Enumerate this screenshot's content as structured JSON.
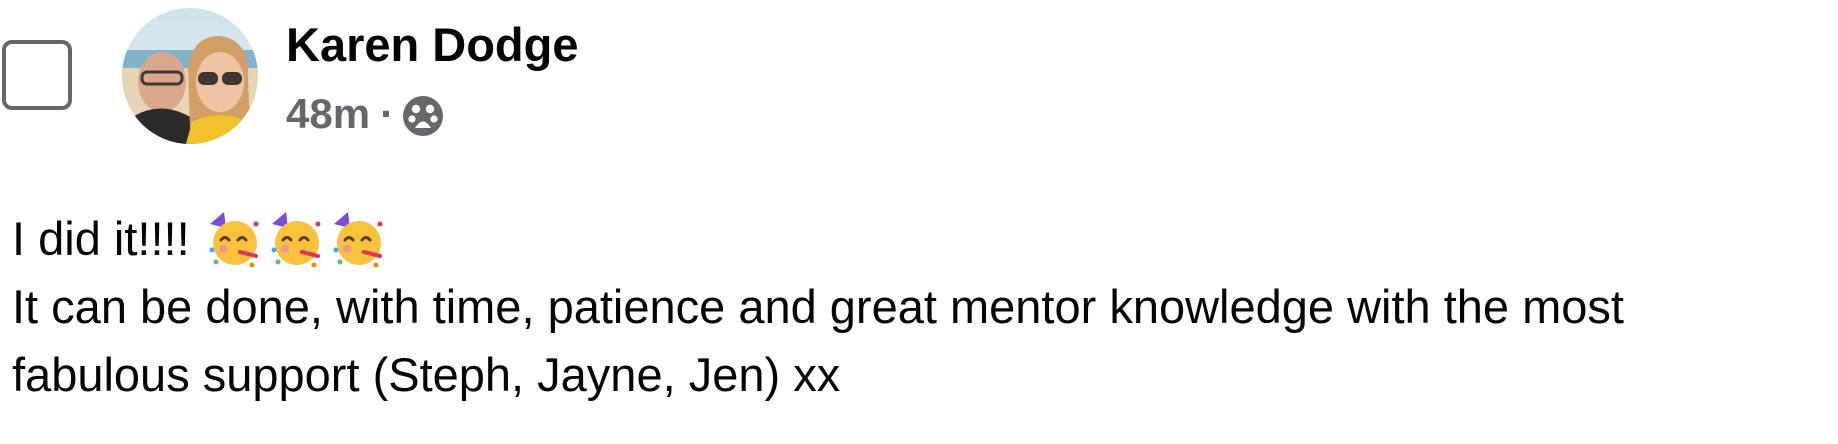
{
  "post": {
    "author_name": "Karen Dodge",
    "timestamp": "48m",
    "separator": "·",
    "audience_icon": "friends-audience-icon",
    "body": {
      "line1": "I did it!!!!",
      "line1_emojis": [
        "partying-face-icon",
        "partying-face-icon",
        "partying-face-icon"
      ],
      "line2a": "It can be done, with time, patience and great mentor knowledge with the most",
      "line2b": "fabulous support (Steph, Jayne, Jen) xx"
    }
  },
  "colors": {
    "text_primary": "#050505",
    "text_secondary": "#65676b",
    "emoji_face": "#f9c23c"
  }
}
